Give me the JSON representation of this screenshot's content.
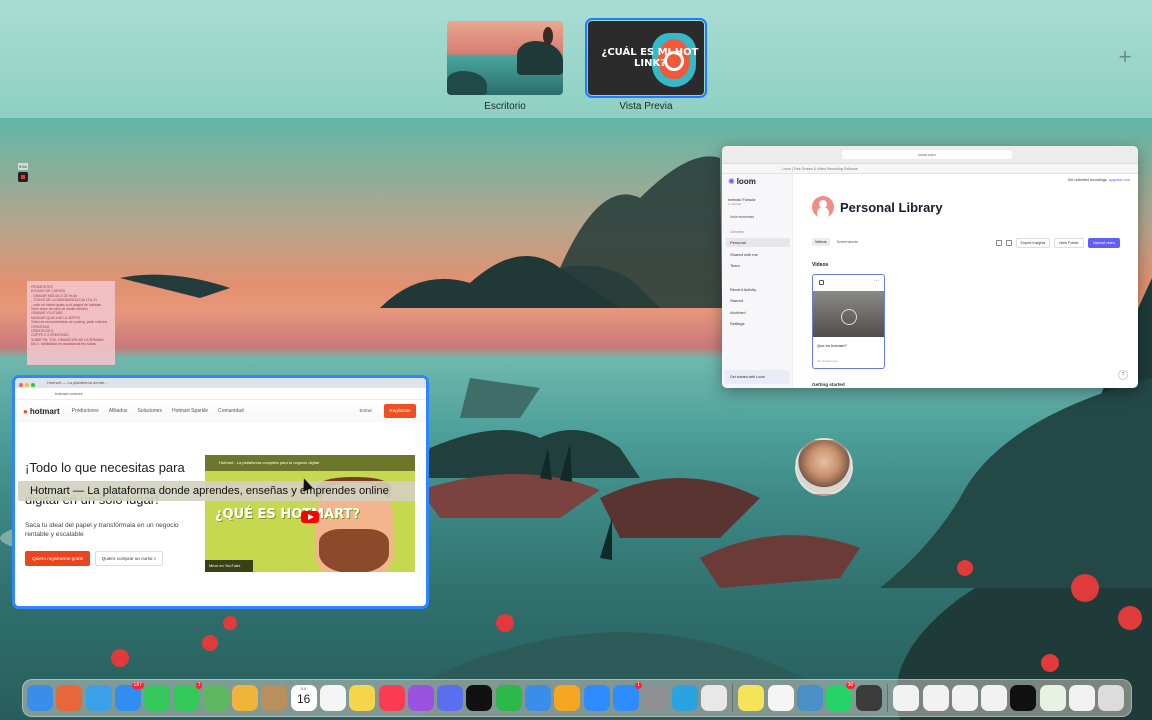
{
  "spaces": {
    "items": [
      {
        "label": "Escritorio",
        "active": false
      },
      {
        "label": "Vista Previa",
        "active": true,
        "thumb_text": "¿CUÁL ES MI HOT LINK?"
      }
    ],
    "add_icon": "plus-icon"
  },
  "sticky_note": {
    "lines": [
      "PENDIENTES",
      "ESTADO DE CUENTA",
      "- GRAVAR MÓDULO 2D 9s 6e",
      "- TODOS DE LA ABUNDANCIA DIA 13 a 21",
      "- subir mi clases gratis a mi pagina de ballistan",
      "",
      "Subir clase de cash de studio efectivo",
      "",
      "GRABAR YOUTUBE",
      "MANDAR QUIZ A MI LA JEFFNI",
      "Video de reconocimiento de posting, pedir criterios",
      "CERVEZAS",
      "CREATIVOS 3",
      "COPYS X 3 CREATIVAS",
      "SUBIR YM, TOK, GRAVACION DE LA SEMANA",
      "",
      "Dia 1: Meditacion en abundancia frio sullas"
    ]
  },
  "loom": {
    "address": "loom.com",
    "tabs_text": "Loom | Free Screen & Video Recording Software",
    "logo": "loom",
    "workspace_name": "metodo Fulsula",
    "workspace_sub": "1 member",
    "invite": "Invite teammates",
    "nav": [
      {
        "label": "Libraries",
        "type": "head"
      },
      {
        "label": "Personal",
        "type": "sel"
      },
      {
        "label": "Shared with me",
        "type": "item"
      },
      {
        "label": "Team",
        "type": "item"
      },
      {
        "label": "",
        "type": "gap"
      },
      {
        "label": "Recent Activity",
        "type": "item"
      },
      {
        "label": "Starred",
        "type": "item"
      },
      {
        "label": "Archived",
        "type": "item"
      },
      {
        "label": "Settings",
        "type": "item"
      }
    ],
    "get_started": "Get started with Loom",
    "top_right": "Get unlimited recordings.",
    "top_right_link": "Upgrade now",
    "title": "Personal Library",
    "subtabs": [
      "Videos",
      "Screenshots"
    ],
    "actions": {
      "export": "Export insights",
      "new_folder": "New Folder",
      "upload": "Upload video"
    },
    "videos_label": "Videos",
    "card": {
      "name": "Que es hotmart?",
      "meta": "44 minutes ago"
    },
    "getting_started": "Getting started"
  },
  "hotmart": {
    "tab": "Hotmart — La plataforma donde...",
    "url": "hotmart.com/es",
    "logo": "hotmart",
    "nav_links": [
      "Productores",
      "Afiliados",
      "Soluciones",
      "Hotmart Sparkle",
      "Comunidad"
    ],
    "entrar": "Entrar",
    "register": "Regístrate",
    "hero_line1": "¡Todo lo que necesitas para",
    "hero_line3": "digital en un solo lugar!",
    "subtitle": "Saca tu ideal del papel y transfórmala en un negocio rentable y escalable",
    "btn_primary": "Quiero registrarme gratis",
    "btn_secondary": "Quiero comprar un curso",
    "video_bar": "Hotmart - La plataforma completa para tu negocio digital",
    "video_big": "¿QUÉ ES HOTMART?",
    "video_watch": "Mirar en YouTube",
    "tooltip": "Hotmart — La plataforma donde aprendes, enseñas y emprendes online"
  },
  "dock": {
    "icons": [
      {
        "name": "finder-icon",
        "color": "#3a8de8"
      },
      {
        "name": "launchpad-icon",
        "color": "#e8673a"
      },
      {
        "name": "safari-icon",
        "color": "#3aa0ea"
      },
      {
        "name": "mail-icon",
        "color": "#2f8ef0",
        "badge": "187"
      },
      {
        "name": "facetime-icon",
        "color": "#34c759"
      },
      {
        "name": "messages-icon",
        "color": "#34c759",
        "badge": "1"
      },
      {
        "name": "maps-icon",
        "color": "#5fb860"
      },
      {
        "name": "photos-icon",
        "color": "#f0b43a"
      },
      {
        "name": "contacts-icon",
        "color": "#b98f5e"
      },
      {
        "name": "calendar-icon",
        "color": "#ffffff"
      },
      {
        "name": "reminders-icon",
        "color": "#f5f5f5"
      },
      {
        "name": "notes-icon",
        "color": "#f7d54a"
      },
      {
        "name": "music-icon",
        "color": "#fa3b52"
      },
      {
        "name": "podcasts-icon",
        "color": "#9b52e0"
      },
      {
        "name": "perplexity-icon",
        "color": "#5a6ef0"
      },
      {
        "name": "appletv-icon",
        "color": "#111111"
      },
      {
        "name": "numbers-icon",
        "color": "#2fb84a"
      },
      {
        "name": "keynote-icon",
        "color": "#3a8de8"
      },
      {
        "name": "pages-icon",
        "color": "#f5a623"
      },
      {
        "name": "zoom-icon",
        "color": "#2d8cff"
      },
      {
        "name": "appstore-icon",
        "color": "#2d8cff",
        "badge": "1"
      },
      {
        "name": "settings-icon",
        "color": "#8e8e93"
      },
      {
        "name": "telegram-icon",
        "color": "#2aa3e0"
      },
      {
        "name": "chrome-icon",
        "color": "#e8e8e8"
      },
      {
        "name": "sep"
      },
      {
        "name": "stickies-icon",
        "color": "#f5e35a"
      },
      {
        "name": "textedit-icon",
        "color": "#f5f5f5"
      },
      {
        "name": "preview-icon",
        "color": "#4a90c8"
      },
      {
        "name": "whatsapp-icon",
        "color": "#25d366",
        "badge": "30"
      },
      {
        "name": "quicktime-icon",
        "color": "#3b3b3b"
      },
      {
        "name": "sep"
      },
      {
        "name": "doc-thumb-icon",
        "color": "#f2f2f2"
      },
      {
        "name": "doc-thumb-icon",
        "color": "#f2f2f2"
      },
      {
        "name": "doc-thumb-icon",
        "color": "#f2f2f2"
      },
      {
        "name": "doc-thumb-icon",
        "color": "#f2f2f2"
      },
      {
        "name": "doc-thumb-icon",
        "color": "#111111"
      },
      {
        "name": "doc-thumb-icon",
        "color": "#e8f2e4"
      },
      {
        "name": "doc-thumb-icon",
        "color": "#f2f2f2"
      },
      {
        "name": "trash-icon",
        "color": "#dcdcdc"
      }
    ],
    "calendar_day": "16",
    "calendar_month": "JUL"
  }
}
